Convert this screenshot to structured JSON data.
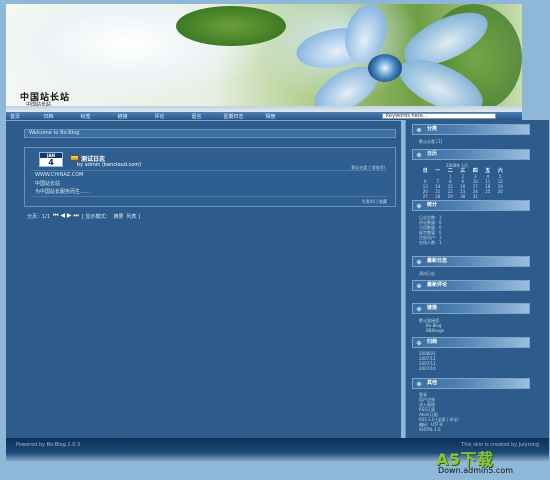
{
  "site": {
    "title": "中国站长站",
    "subtitle": "中国站长站"
  },
  "nav": {
    "items": [
      "首页",
      "归档",
      "标签",
      "链接",
      "评论",
      "留言",
      "星期日志",
      "相册"
    ],
    "search_placeholder": "Keywords here..."
  },
  "main": {
    "welcome": "Welcome to Bo-Blog.",
    "post": {
      "month": "JAN",
      "day": "4",
      "title": "测试日志",
      "author": "by admin (bencloud.com)",
      "meta": "默认分类 | 浏览(0)",
      "body_1": "WWW.CHINAZ.COM",
      "body_2": "中国站长站",
      "body_3": "为中国站长服务而生……",
      "foot": "引用(0) | 收藏"
    },
    "pager": {
      "label": "分页：1/1",
      "arrows": "⏮ ◀ ▶ ⏭",
      "view_mode": "[ 显示模式：",
      "summary": "摘要",
      "list": "列表 ]"
    }
  },
  "sidebar": {
    "categories_title": "分类",
    "categories_text": "默认分类 [1]",
    "calendar_title": "日历",
    "calendar_nav": "2008年 1月",
    "calendar_days": [
      "日",
      "一",
      "二",
      "三",
      "四",
      "五",
      "六"
    ],
    "calendar_rows": [
      [
        "",
        "",
        "1",
        "2",
        "3",
        "4",
        "5"
      ],
      [
        "6",
        "7",
        "8",
        "9",
        "10",
        "11",
        "12"
      ],
      [
        "13",
        "14",
        "15",
        "16",
        "17",
        "18",
        "19"
      ],
      [
        "20",
        "21",
        "22",
        "23",
        "24",
        "25",
        "26"
      ],
      [
        "27",
        "28",
        "29",
        "30",
        "31",
        "",
        ""
      ]
    ],
    "stats_title": "统计",
    "stats_items": [
      "日志总数：1",
      "评论数量：0",
      "引用数量：0",
      "留言数量：0",
      "注册用户：1",
      "在线人数：1"
    ],
    "latest_title": "最新日志",
    "latest_items": [
      "测试日志"
    ],
    "comments_title": "最新评论",
    "links_title": "链接",
    "links_items": [
      "默认链接组",
      "Bo-Blog",
      "BBRouge"
    ],
    "archive_title": "归档",
    "archive_items": [
      "2008/01",
      "2007/12",
      "2007/11",
      "2007/10"
    ],
    "other_title": "其他",
    "other_items": [
      "登录",
      "用户注册",
      "进入管理",
      "RSS订阅",
      "Atom订阅",
      "RSS 2.0 (全部 | 评论)",
      "编码：UTF-8",
      "XHTML 1.0"
    ]
  },
  "footer": {
    "left": "Powered by Bo-Blog 2.0.3",
    "right": "This skin is created by Julyrong"
  },
  "watermark": {
    "logo": "A5下载",
    "url": "Down.admin5.com"
  }
}
